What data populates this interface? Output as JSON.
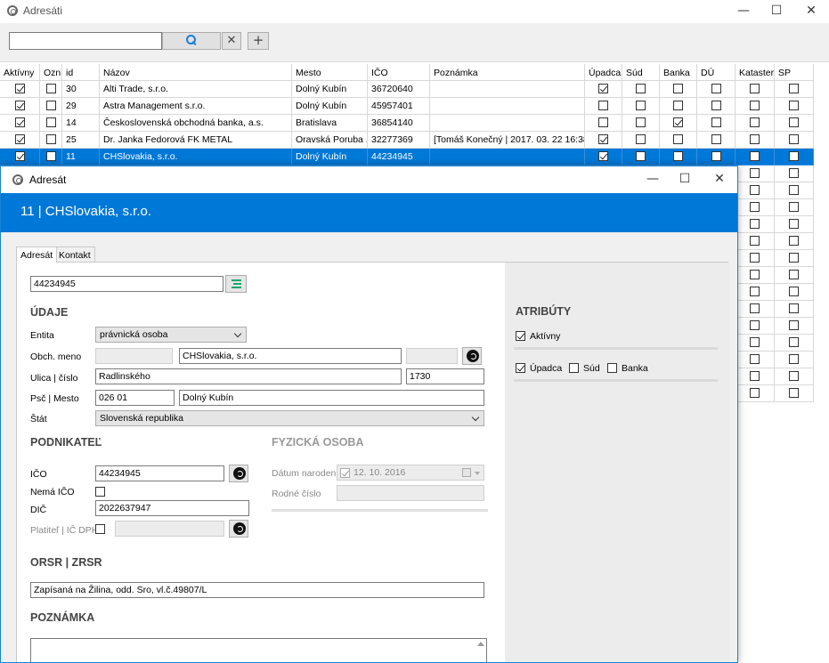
{
  "main_window": {
    "title": "Adresáti",
    "minimize": "—",
    "maximize": "☐",
    "close": "✕"
  },
  "toolbar": {
    "search_value": "",
    "clear_label": "✕",
    "add_label": "+"
  },
  "grid": {
    "headers": [
      "Aktívny",
      "Ozn",
      "id",
      "Názov",
      "Mesto",
      "IČO",
      "Poznámka",
      "Úpadca",
      "Súd",
      "Banka",
      "DÚ",
      "Kataster",
      "SP"
    ],
    "rows": [
      {
        "aktivny": true,
        "ozn": false,
        "id": "30",
        "nazov": "Alti Trade, s.r.o.",
        "mesto": "Dolný Kubín",
        "ico": "36720640",
        "poznamka": "",
        "upadca": true,
        "sud": false,
        "banka": false,
        "du": false,
        "kataster": false,
        "sp": false
      },
      {
        "aktivny": true,
        "ozn": false,
        "id": "29",
        "nazov": "Astra Management s.r.o.",
        "mesto": "Dolný Kubín",
        "ico": "45957401",
        "poznamka": "",
        "upadca": false,
        "sud": false,
        "banka": false,
        "du": false,
        "kataster": false,
        "sp": false
      },
      {
        "aktivny": true,
        "ozn": false,
        "id": "14",
        "nazov": "Československá obchodná banka, a.s.",
        "mesto": "Bratislava",
        "ico": "36854140",
        "poznamka": "",
        "upadca": false,
        "sud": false,
        "banka": true,
        "du": false,
        "kataster": false,
        "sp": false
      },
      {
        "aktivny": true,
        "ozn": false,
        "id": "25",
        "nazov": "Dr. Janka Fedorová FK METAL",
        "mesto": "Oravská Poruba ...",
        "ico": "32277369",
        "poznamka": "[Tomáš Konečný | 2017. 03. 22 16:38:...",
        "upadca": true,
        "sud": false,
        "banka": false,
        "du": false,
        "kataster": false,
        "sp": false
      },
      {
        "aktivny": true,
        "ozn": false,
        "id": "11",
        "nazov": "CHSlovakia, s.r.o.",
        "mesto": "Dolný Kubín",
        "ico": "44234945",
        "poznamka": "",
        "upadca": true,
        "sud": false,
        "banka": false,
        "du": false,
        "kataster": false,
        "sp": false,
        "selected": true
      }
    ],
    "filler_row_count": 14
  },
  "dialog": {
    "title": "Adresát",
    "minimize": "—",
    "maximize": "☐",
    "close": "✕",
    "header": "11 | CHSlovakia, s.r.o.",
    "tabs": [
      "Adresát",
      "Kontakt"
    ],
    "ico_lookup_value": "44234945",
    "udaje": {
      "title": "ÚDAJE",
      "entita_label": "Entita",
      "entita_value": "právnická osoba",
      "obch_meno_label": "Obch. meno",
      "obch_meno_prefix": "",
      "obch_meno_value": "CHSlovakia, s.r.o.",
      "obch_meno_suffix": "",
      "ulica_label": "Ulica | číslo",
      "ulica_value": "Radlinského",
      "cislo_value": "1730",
      "psc_label": "Psč | Mesto",
      "psc_value": "026 01",
      "mesto_value": "Dolný Kubín",
      "stat_label": "Štát",
      "stat_value": "Slovenská republika"
    },
    "podnikatel": {
      "title": "PODNIKATEĽ",
      "ico_label": "IČO",
      "ico_value": "44234945",
      "nema_ico_label": "Nemá IČO",
      "nema_ico": false,
      "dic_label": "DIČ",
      "dic_value": "2022637947",
      "platitel_label": "Platiteľ | IČ DPH",
      "platitel": false,
      "ic_dph_value": ""
    },
    "fyzicka": {
      "title": "FYZICKÁ OSOBA",
      "datum_label": "Dátum narodenia",
      "datum_value": "12. 10. 2016",
      "rodne_label": "Rodné číslo",
      "rodne_value": ""
    },
    "orsr": {
      "title": "ORSR | ZRSR",
      "value": "Zapísaná na Žilina, odd. Sro, vl.č.49807/L"
    },
    "poznamka": {
      "title": "POZNÁMKA",
      "value": ""
    },
    "atributy": {
      "title": "ATRIBÚTY",
      "aktivny_label": "Aktívny",
      "aktivny": true,
      "upadca_label": "Úpadca",
      "upadca": true,
      "sud_label": "Súd",
      "sud": false,
      "banka_label": "Banka",
      "banka": false
    }
  },
  "colors": {
    "accent": "#0078d7",
    "lookup_icon": "#13a66d"
  }
}
